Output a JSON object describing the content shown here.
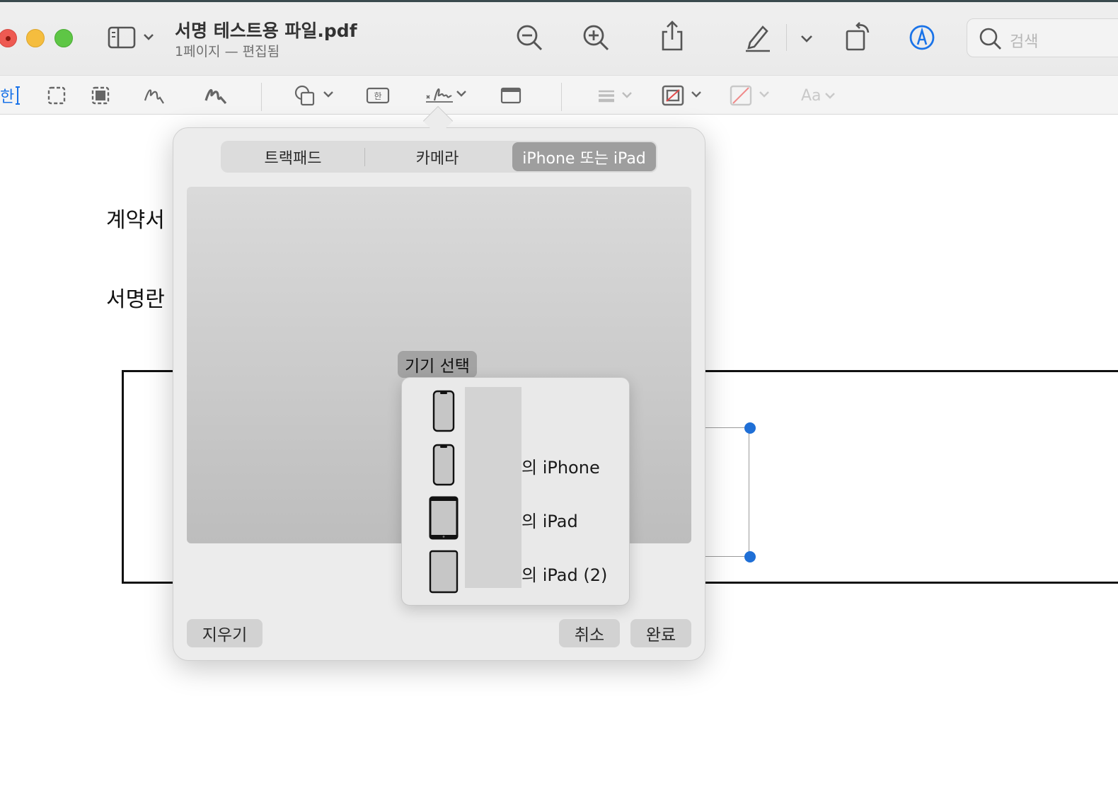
{
  "window": {
    "title": "서명 테스트용 파일.pdf",
    "subtitle": "1페이지 — 편집됨"
  },
  "toolbar": {
    "search_placeholder": "검색",
    "icons": [
      "sidebar-icon",
      "zoom-out-icon",
      "zoom-in-icon",
      "share-icon",
      "highlight-icon",
      "rotate-icon",
      "markup-icon",
      "search-icon"
    ]
  },
  "markup_toolbar": {
    "text_tool_label": "한",
    "textbox_icon_label": "한",
    "font_label": "Aa",
    "accent_color": "#1a73e8"
  },
  "document": {
    "heading1": "계약서",
    "heading2": "서명란"
  },
  "popover": {
    "tabs": [
      {
        "label": "트랙패드",
        "active": false
      },
      {
        "label": "카메라",
        "active": false
      },
      {
        "label": "iPhone 또는 iPad",
        "active": true
      }
    ],
    "device_select_label": "기기 선택",
    "devices": [
      {
        "icon": "iphone-icon",
        "label": ""
      },
      {
        "icon": "iphone-icon",
        "label": "의 iPhone"
      },
      {
        "icon": "ipad-icon",
        "label": "의 iPad"
      },
      {
        "icon": "ipad-icon",
        "label": "의 iPad (2)"
      }
    ],
    "clear_label": "지우기",
    "cancel_label": "취소",
    "done_label": "완료"
  }
}
